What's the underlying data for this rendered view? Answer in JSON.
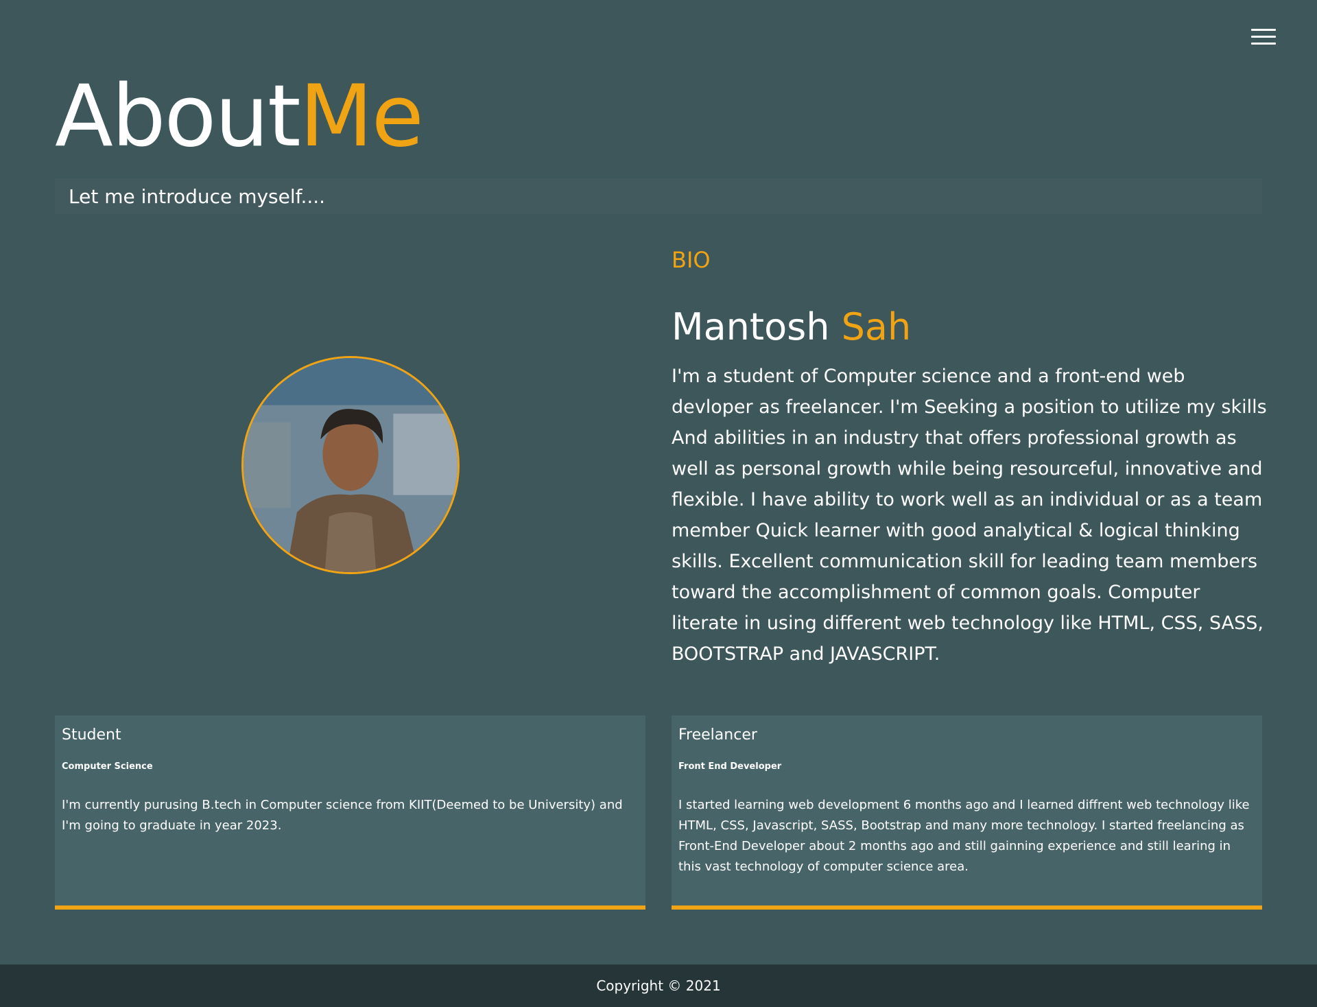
{
  "header": {
    "menu_icon": "hamburger-menu-icon",
    "title_main": "About",
    "title_accent": "Me",
    "intro": "Let me introduce myself...."
  },
  "profile": {
    "photo_alt": "profile-photo"
  },
  "bio": {
    "label": "BIO",
    "first_name": "Mantosh",
    "last_name": "Sah",
    "text": "I'm a student of Computer science and a front-end web devloper as freelancer. I'm Seeking a position to utilize my skills And abilities in an industry that offers professional growth as well as personal growth while being resourceful, innovative and flexible. I have ability to work well as an individual or as a team member Quick learner with good analytical & logical thinking skills. Excellent communication skill for leading team members toward the accomplishment of common goals. Computer literate in using different web technology like HTML, CSS, SASS, BOOTSTRAP and JAVASCRIPT."
  },
  "cards": [
    {
      "title": "Student",
      "subtitle": "Computer Science",
      "text": "I'm currently purusing B.tech in Computer science from KIIT(Deemed to be University) and I'm going to graduate in year 2023."
    },
    {
      "title": "Freelancer",
      "subtitle": "Front End Developer",
      "text": "I started learning web development 6 months ago and I learned diffrent web technology like HTML, CSS, Javascript, SASS, Bootstrap and many more technology. I started freelancing as Front-End Developer about 2 months ago and still gainning experience and still learing in this vast technology of computer science area."
    }
  ],
  "footer": {
    "copyright": "Copyright © 2021"
  },
  "colors": {
    "background": "#3d575b",
    "accent": "#f0a313",
    "card": "#476468",
    "footer": "#263538"
  }
}
